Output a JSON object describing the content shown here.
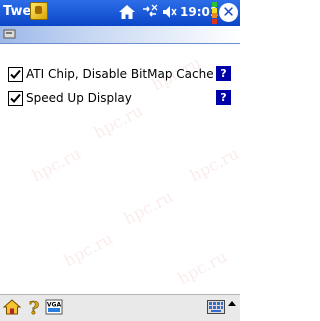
{
  "titlebar": {
    "app_title": "Twe",
    "clock": "19:01",
    "battery_colors": [
      "#2cc22c",
      "#f0e020",
      "#f08c1e",
      "#e0321e"
    ]
  },
  "options": [
    {
      "label": "ATI Chip, Disable BitMap Cache",
      "checked": true,
      "help": "?"
    },
    {
      "label": "Speed Up Display",
      "checked": true,
      "help": "?"
    }
  ],
  "watermark": "hpc.ru",
  "icons": {
    "app": "tweaks-app-icon",
    "home": "home-icon",
    "network": "network-icon",
    "volume": "volume-icon",
    "close": "close-icon",
    "header": "drive-icon",
    "bottom": [
      "home-icon",
      "help-icon",
      "vga-icon"
    ],
    "keyboard": "keyboard-icon"
  },
  "bottombar": {
    "vga_label": "VGA"
  }
}
